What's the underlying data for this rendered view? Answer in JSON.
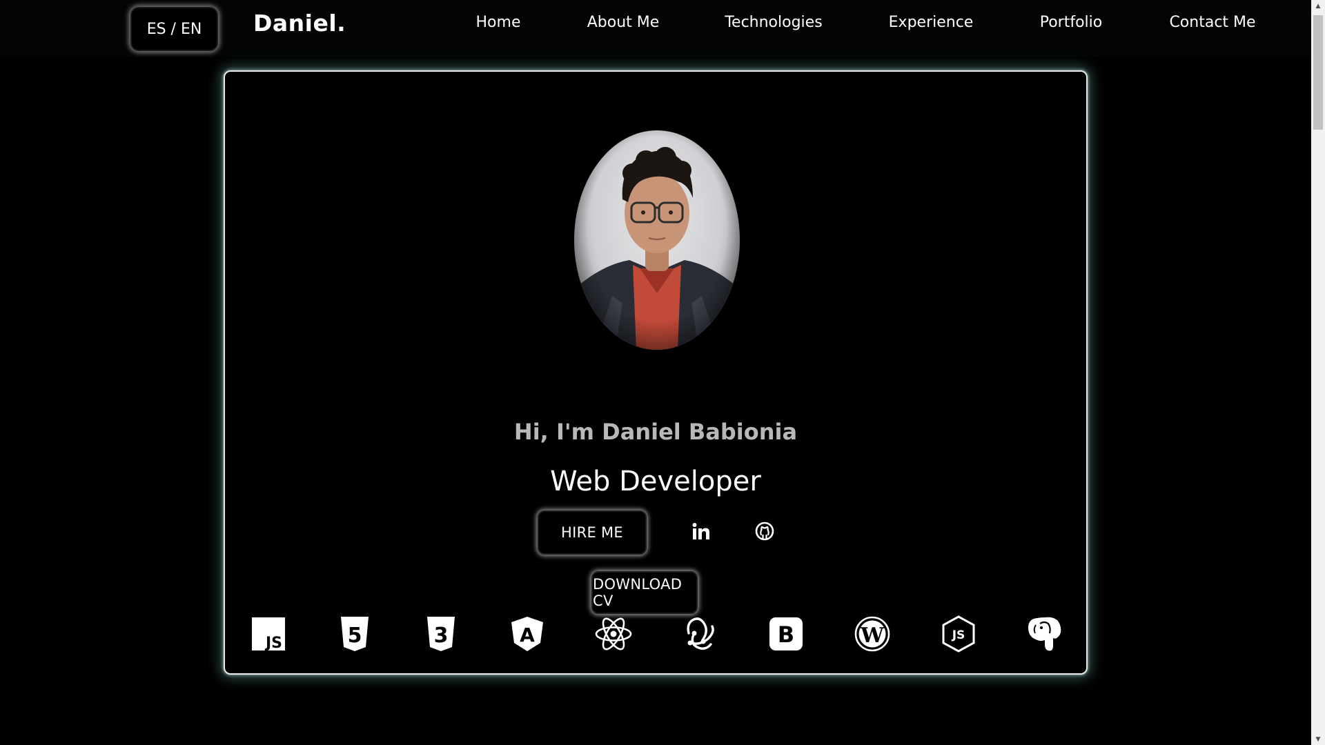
{
  "nav": {
    "lang_toggle": "ES / EN",
    "brand": "Daniel.",
    "links": [
      {
        "label": "Home"
      },
      {
        "label": "About Me"
      },
      {
        "label": "Technologies"
      },
      {
        "label": "Experience"
      },
      {
        "label": "Portfolio"
      },
      {
        "label": "Contact Me"
      }
    ]
  },
  "hero": {
    "greeting": "Hi, I'm Daniel Babionia",
    "role": "Web Developer",
    "hire_label": "HIRE ME",
    "cv_label": "DOWNLOAD CV",
    "socials": [
      {
        "icon": "linkedin-icon"
      },
      {
        "icon": "github-icon"
      }
    ],
    "technologies": [
      {
        "icon": "javascript-icon",
        "text": "JS"
      },
      {
        "icon": "html5-icon",
        "text": "5"
      },
      {
        "icon": "css3-icon",
        "text": "3"
      },
      {
        "icon": "angular-icon",
        "text": "A"
      },
      {
        "icon": "react-icon"
      },
      {
        "icon": "redux-icon"
      },
      {
        "icon": "bootstrap-icon",
        "text": "B"
      },
      {
        "icon": "wordpress-icon",
        "text": "W"
      },
      {
        "icon": "nodejs-icon",
        "text": "JS"
      },
      {
        "icon": "postgresql-icon"
      }
    ]
  },
  "colors": {
    "background": "#000000",
    "glow": "#7fc8be",
    "greeting_text": "#b8b8b8"
  }
}
